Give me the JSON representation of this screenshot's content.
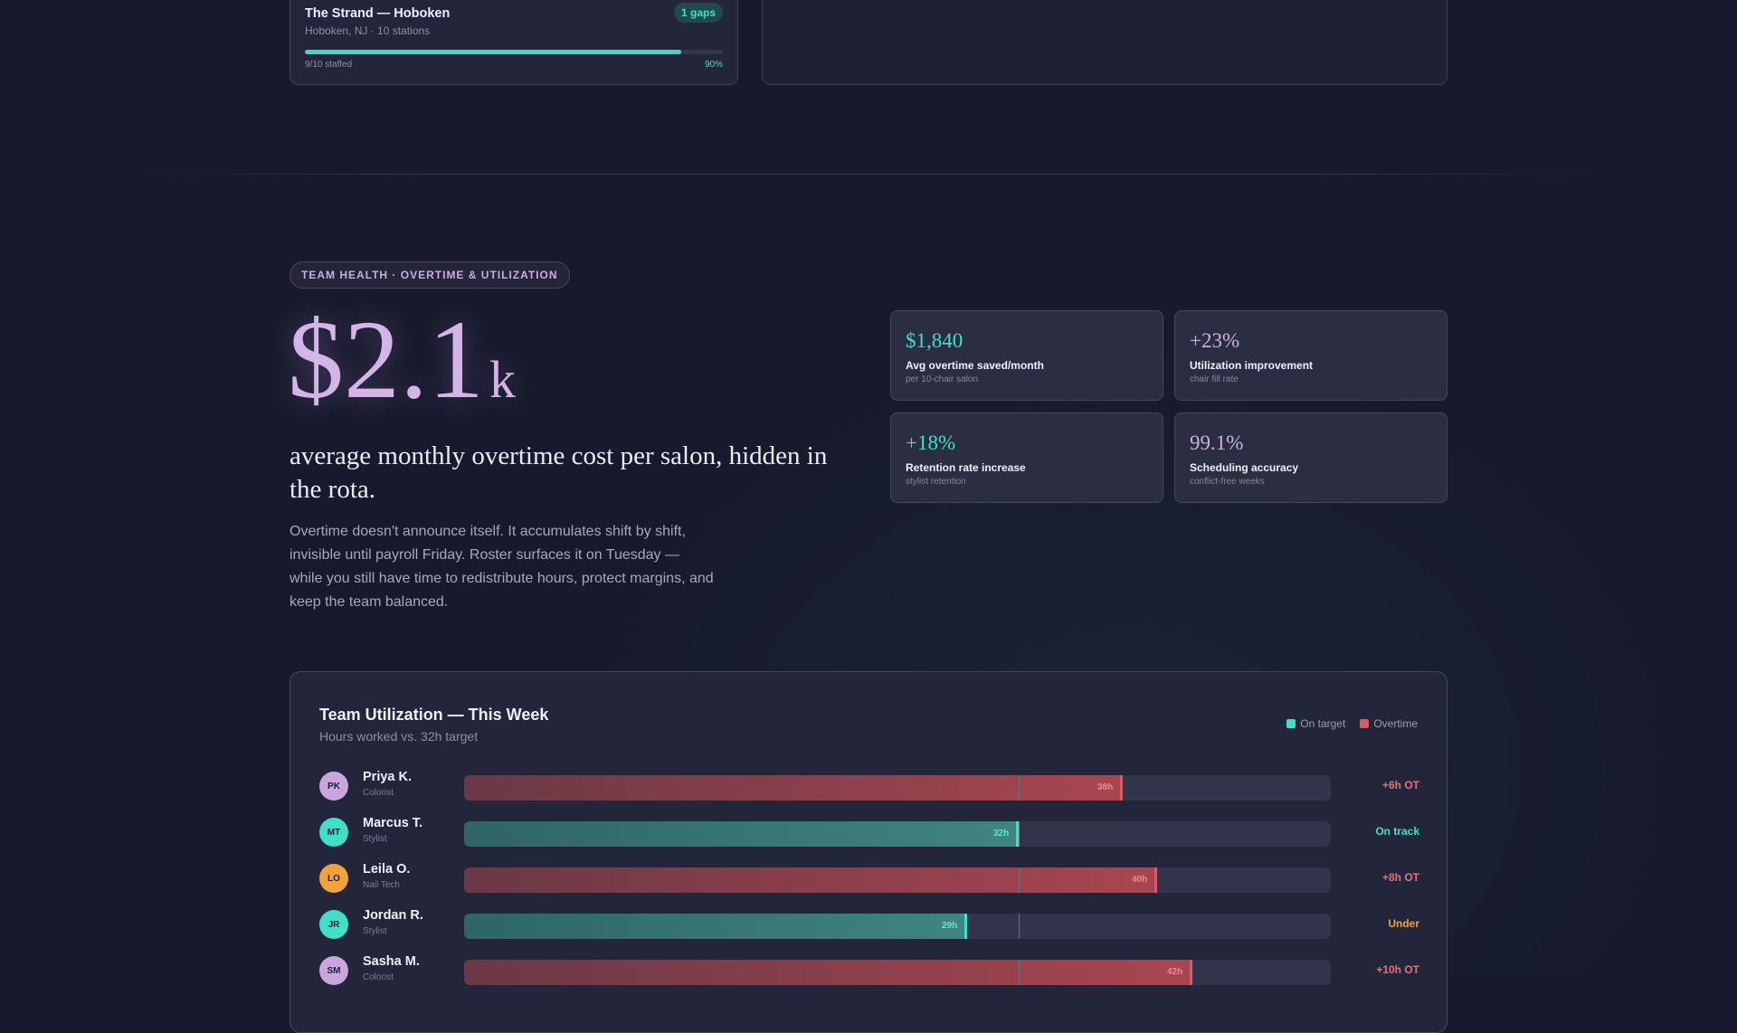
{
  "salon_card": {
    "name": "The Strand — Hoboken",
    "meta": "Hoboken, NJ · 10 stations",
    "badge": "1 gaps",
    "staffed_text": "9/10 staffed",
    "percent_text": "90%",
    "fill_fraction": 0.9
  },
  "section": {
    "tag": "TEAM HEALTH · OVERTIME & UTILIZATION",
    "big_number": "$2.1",
    "big_suffix": "k",
    "headline": "average monthly overtime cost per salon, hidden in the rota.",
    "lede": "Overtime doesn't announce itself. It accumulates shift by shift, invisible until payroll Friday. Roster surfaces it on Tuesday — while you still have time to redistribute hours, protect margins, and keep the team balanced."
  },
  "stats": [
    {
      "value": "$1,840",
      "label": "Avg overtime saved/month",
      "sub": "per 10-chair salon",
      "tone": "teal"
    },
    {
      "value": "+23%",
      "label": "Utilization improvement",
      "sub": "chair fill rate",
      "tone": "lav"
    },
    {
      "value": "+18%",
      "label": "Retention rate increase",
      "sub": "stylist retention",
      "tone": "teal"
    },
    {
      "value": "99.1%",
      "label": "Scheduling accuracy",
      "sub": "conflict-free weeks",
      "tone": "lav"
    }
  ],
  "utilization": {
    "title": "Team Utilization — This Week",
    "subtitle": "Hours worked vs. 32h target",
    "legend": [
      {
        "label": "On target",
        "color": "#3ee0c8"
      },
      {
        "label": "Overtime",
        "color": "#d95b63"
      }
    ],
    "target_hours": 32,
    "max_hours": 50,
    "rows": [
      {
        "initials": "PK",
        "name": "Priya K.",
        "role": "Colorist",
        "hours": 38,
        "hours_label": "38h",
        "status": "+6h OT",
        "kind": "over",
        "avatar_color": "#c9a6dc"
      },
      {
        "initials": "MT",
        "name": "Marcus T.",
        "role": "Stylist",
        "hours": 32,
        "hours_label": "32h",
        "status": "On track",
        "kind": "ok",
        "avatar_color": "#3ee0c8"
      },
      {
        "initials": "LO",
        "name": "Leila O.",
        "role": "Nail Tech",
        "hours": 40,
        "hours_label": "40h",
        "status": "+8h OT",
        "kind": "over",
        "avatar_color": "#f0a33a"
      },
      {
        "initials": "JR",
        "name": "Jordan R.",
        "role": "Stylist",
        "hours": 29,
        "hours_label": "29h",
        "status": "Under",
        "kind": "ok",
        "avatar_color": "#3ee0c8"
      },
      {
        "initials": "SM",
        "name": "Sasha M.",
        "role": "Colorist",
        "hours": 42,
        "hours_label": "42h",
        "status": "+10h OT",
        "kind": "over",
        "avatar_color": "#c9a6dc"
      }
    ]
  },
  "status_colors": {
    "over": "#e8707a",
    "ok": "#3ee0c8",
    "under": "#f0a33a"
  }
}
